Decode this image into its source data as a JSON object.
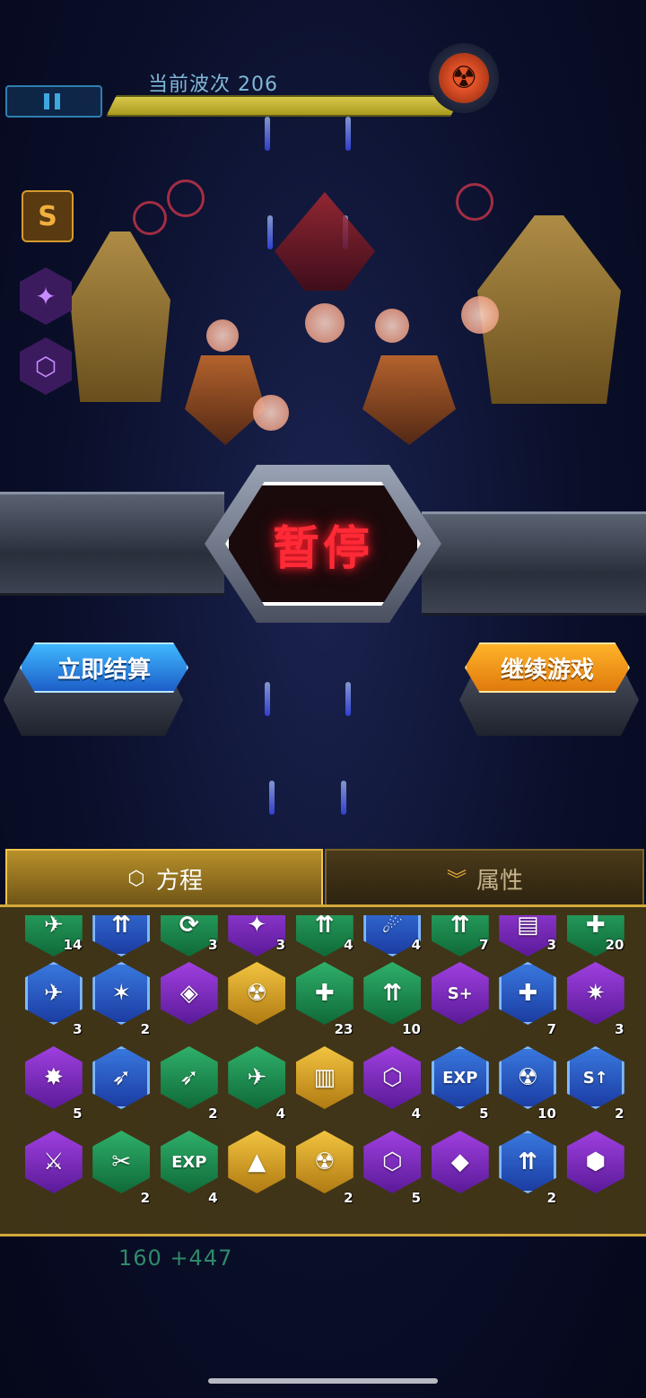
{
  "hud": {
    "wave_label": "当前波次 206",
    "pause_icon": "pause-icon",
    "nuke_icon": "nuclear-icon",
    "rank_badge": "S"
  },
  "pause_panel": {
    "title": "暂停",
    "settle_button": "立即结算",
    "continue_button": "继续游戏"
  },
  "tabs": [
    {
      "label": "方程",
      "icon": "formula-icon",
      "active": true
    },
    {
      "label": "属性",
      "icon": "chevron-double-down-icon",
      "active": false
    }
  ],
  "skills": {
    "row0": [
      {
        "color": "green",
        "glyph": "✈",
        "count": "14"
      },
      {
        "color": "blue",
        "glyph": "⇈",
        "count": ""
      },
      {
        "color": "green",
        "glyph": "⟳",
        "count": "3"
      },
      {
        "color": "purple",
        "glyph": "✦",
        "count": "3"
      },
      {
        "color": "green",
        "glyph": "⇈",
        "count": "4"
      },
      {
        "color": "blue",
        "glyph": "☄",
        "count": "4"
      },
      {
        "color": "green",
        "glyph": "⇈",
        "count": "7"
      },
      {
        "color": "purple",
        "glyph": "▤",
        "count": "3"
      },
      {
        "color": "green",
        "glyph": "✚",
        "count": "20"
      }
    ],
    "row1": [
      {
        "color": "blue",
        "glyph": "✈",
        "count": "3"
      },
      {
        "color": "blue",
        "glyph": "✶",
        "count": "2"
      },
      {
        "color": "purple",
        "glyph": "◈",
        "count": ""
      },
      {
        "color": "gold",
        "glyph": "☢",
        "count": ""
      },
      {
        "color": "green",
        "glyph": "✚",
        "count": "23"
      },
      {
        "color": "green",
        "glyph": "⇈",
        "count": "10"
      },
      {
        "color": "purple",
        "glyph": "S+",
        "count": ""
      },
      {
        "color": "blue",
        "glyph": "✚",
        "count": "7"
      },
      {
        "color": "purple",
        "glyph": "✷",
        "count": "3"
      }
    ],
    "row2": [
      {
        "color": "purple",
        "glyph": "✸",
        "count": "5"
      },
      {
        "color": "blue",
        "glyph": "➶",
        "count": ""
      },
      {
        "color": "green",
        "glyph": "➶",
        "count": "2"
      },
      {
        "color": "green",
        "glyph": "✈",
        "count": "4"
      },
      {
        "color": "gold",
        "glyph": "▥",
        "count": ""
      },
      {
        "color": "purple",
        "glyph": "⬡",
        "count": "4"
      },
      {
        "color": "blue",
        "glyph": "EXP",
        "count": "5"
      },
      {
        "color": "blue",
        "glyph": "☢",
        "count": "10"
      },
      {
        "color": "blue",
        "glyph": "S↑",
        "count": "2"
      }
    ],
    "row3": [
      {
        "color": "purple",
        "glyph": "⚔",
        "count": ""
      },
      {
        "color": "green",
        "glyph": "✂",
        "count": "2"
      },
      {
        "color": "green",
        "glyph": "EXP",
        "count": "4"
      },
      {
        "color": "gold",
        "glyph": "▲",
        "count": ""
      },
      {
        "color": "gold",
        "glyph": "☢",
        "count": "2"
      },
      {
        "color": "purple",
        "glyph": "⬡",
        "count": "5"
      },
      {
        "color": "purple",
        "glyph": "◆",
        "count": ""
      },
      {
        "color": "blue",
        "glyph": "⇈",
        "count": "2"
      },
      {
        "color": "purple",
        "glyph": "⬢",
        "count": ""
      }
    ]
  },
  "score": "160 +447",
  "colors": {
    "accent_gold": "#d4a83a",
    "pause_red": "#ff2a36",
    "settle_blue": "#1d5ec8",
    "continue_orange": "#e07a0c"
  }
}
